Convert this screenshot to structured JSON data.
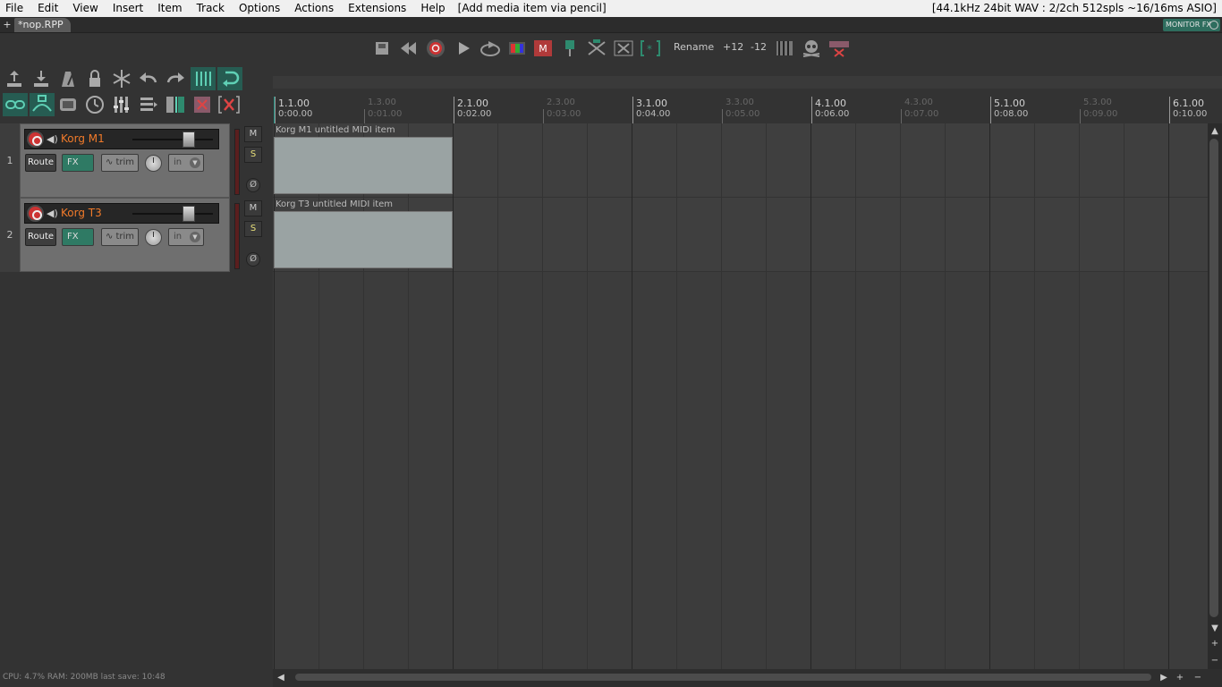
{
  "menubar": {
    "items": [
      "File",
      "Edit",
      "View",
      "Insert",
      "Item",
      "Track",
      "Options",
      "Actions",
      "Extensions",
      "Help"
    ],
    "hint": "[Add media item via pencil]",
    "status": "[44.1kHz 24bit WAV : 2/2ch 512spls ~16/16ms ASIO]"
  },
  "tabs": {
    "add": "+",
    "project": "*nop.RPP",
    "monitor_fx": "MONITOR FX"
  },
  "transport": {
    "rename": "Rename",
    "plus12": "+12",
    "minus12": "-12",
    "m_label": "M"
  },
  "ruler": {
    "marks": [
      {
        "bar": "1.1.00",
        "time": "0:00.00",
        "minor": false
      },
      {
        "bar": "1.3.00",
        "time": "0:01.00",
        "minor": true
      },
      {
        "bar": "2.1.00",
        "time": "0:02.00",
        "minor": false
      },
      {
        "bar": "2.3.00",
        "time": "0:03.00",
        "minor": true
      },
      {
        "bar": "3.1.00",
        "time": "0:04.00",
        "minor": false
      },
      {
        "bar": "3.3.00",
        "time": "0:05.00",
        "minor": true
      },
      {
        "bar": "4.1.00",
        "time": "0:06.00",
        "minor": false
      },
      {
        "bar": "4.3.00",
        "time": "0:07.00",
        "minor": true
      },
      {
        "bar": "5.1.00",
        "time": "0:08.00",
        "minor": false
      },
      {
        "bar": "5.3.00",
        "time": "0:09.00",
        "minor": true
      },
      {
        "bar": "6.1.00",
        "time": "0:10.00",
        "minor": false
      }
    ]
  },
  "tracks": [
    {
      "number": "1",
      "name": "Korg M1",
      "route": "Route",
      "fx": "FX",
      "trim": "trim",
      "input": "in",
      "mute": "M",
      "solo": "S",
      "phase": "Ø",
      "item": "Korg M1 untitled MIDI item"
    },
    {
      "number": "2",
      "name": "Korg T3",
      "route": "Route",
      "fx": "FX",
      "trim": "trim",
      "input": "in",
      "mute": "M",
      "solo": "S",
      "phase": "Ø",
      "item": "Korg T3 untitled MIDI item"
    }
  ],
  "statusbar": "CPU: 4.7% RAM: 200MB  last save: 10:48",
  "colors": {
    "accent": "#265c52",
    "track_name": "#f07a2a",
    "record": "#cc3333",
    "item_body": "#9aa3a3",
    "edit_cursor": "#1f8f80"
  },
  "icons": {
    "toolbar1": [
      "import-up-icon",
      "import-down-icon",
      "metronome-icon",
      "lock-icon",
      "freeze-icon",
      "undo-icon",
      "redo-icon",
      "grid-icon",
      "loop-icon"
    ],
    "toolbar2": [
      "link-icon",
      "ripple-icon",
      "monitor-icon",
      "clock-icon",
      "mixer-icon",
      "list-icon",
      "split-icon",
      "close-box-icon",
      "close-x-icon"
    ],
    "transport": [
      "save-icon",
      "rewind-icon",
      "record-icon",
      "play-icon",
      "loop-play-icon",
      "color-icon",
      "marker-icon",
      "pin-icon",
      "cut-icon",
      "x-split-icon",
      "bracket-icon",
      "piano-icon",
      "skull-icon",
      "crossfade-icon"
    ]
  }
}
